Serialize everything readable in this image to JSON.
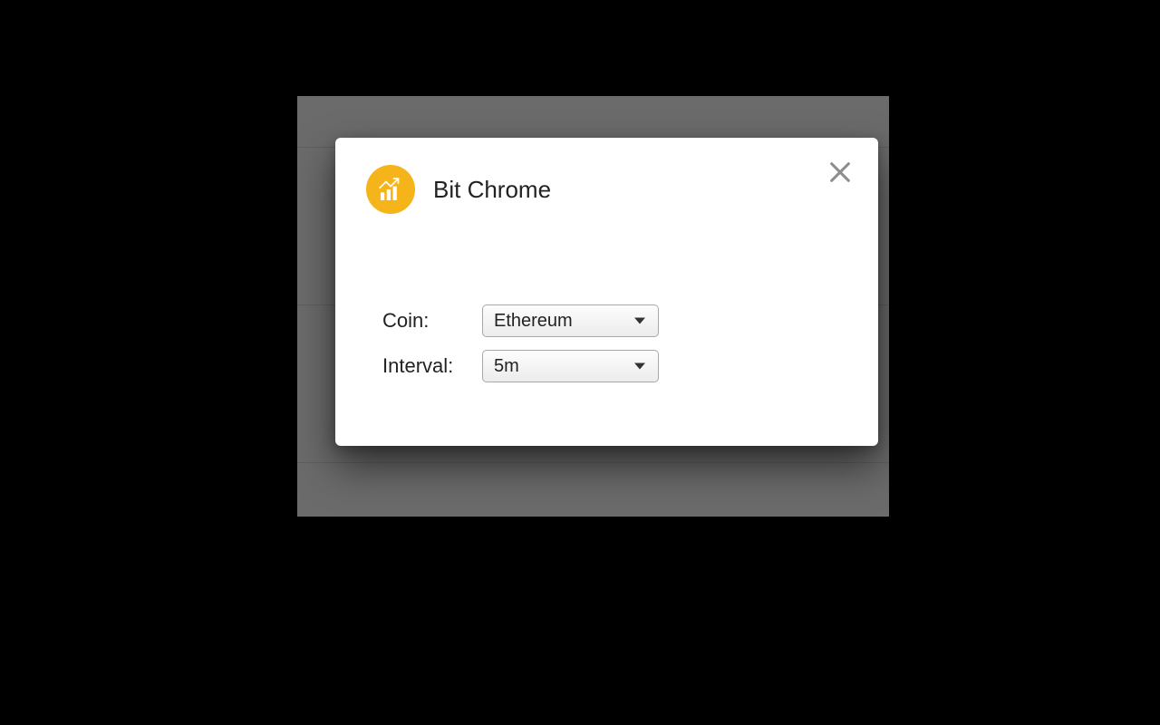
{
  "dialog": {
    "title": "Bit Chrome",
    "icon": "chart-icon",
    "close_label": "Close"
  },
  "form": {
    "coin": {
      "label": "Coin:",
      "selected": "Ethereum"
    },
    "interval": {
      "label": "Interval:",
      "selected": "5m"
    }
  },
  "colors": {
    "accent": "#f4b41a",
    "panel": "#6b6b6b",
    "close_icon": "#8d8d8d"
  }
}
